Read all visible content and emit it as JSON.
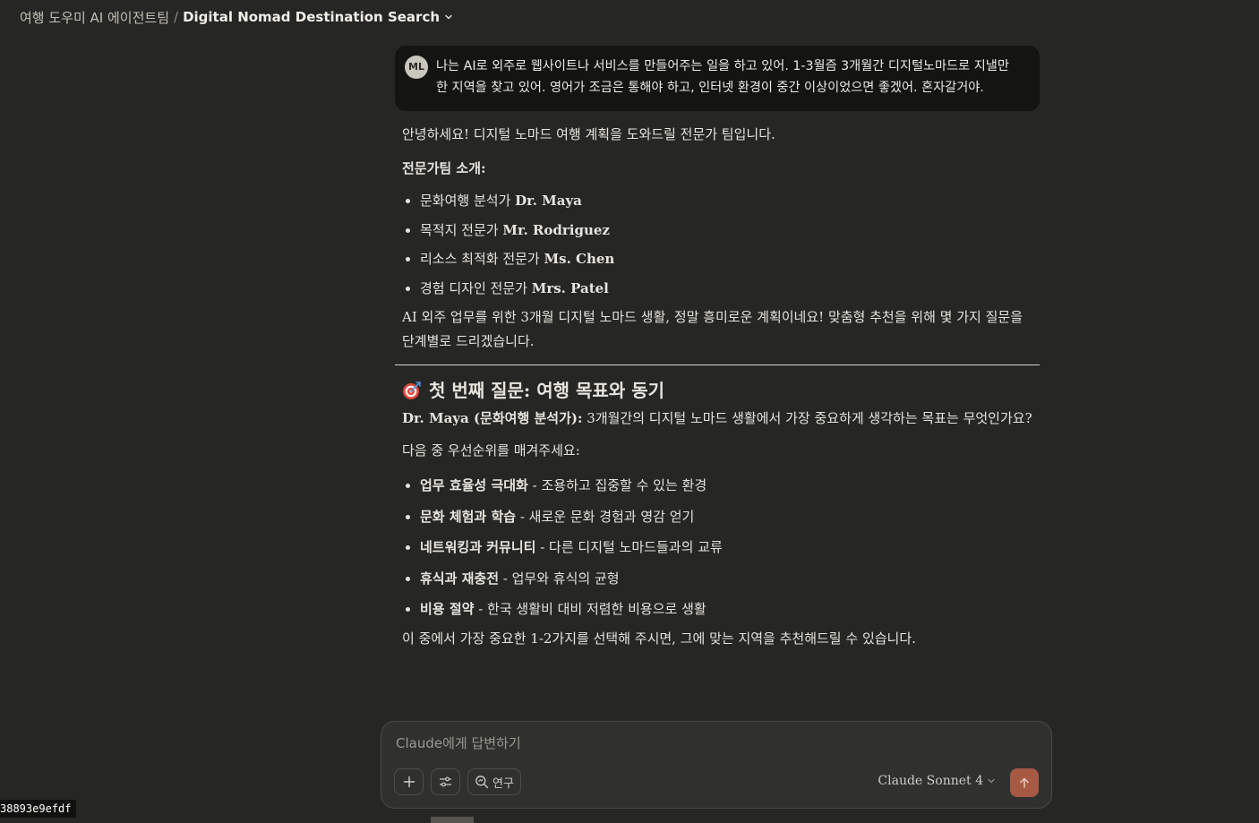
{
  "header": {
    "project": "여행 도우미 AI 에이전트팀",
    "separator": "/",
    "title": "Digital Nomad Destination Search"
  },
  "user_message": {
    "avatar_initials": "ML",
    "text": "나는 AI로 외주로 웹사이트나 서비스를 만들어주는 일을 하고 있어. 1-3월즘 3개월간 디지털노마드로 지낼만한 지역을 찾고 있어. 영어가 조금은 통해야 하고, 인터넷 환경이 중간 이상이었으면 좋겠어. 혼자갈거야."
  },
  "assistant": {
    "intro": "안녕하세요! 디지털 노마드 여행 계획을 도와드릴 전문가 팀입니다.",
    "team_title": "전문가팀 소개:",
    "team": [
      {
        "role": "문화여행 분석가 ",
        "name": "Dr. Maya"
      },
      {
        "role": "목적지 전문가 ",
        "name": "Mr. Rodriguez"
      },
      {
        "role": "리소스 최적화 전문가 ",
        "name": "Ms. Chen"
      },
      {
        "role": "경험 디자인 전문가 ",
        "name": "Mrs. Patel"
      }
    ],
    "para2": "AI 외주 업무를 위한 3개월 디지털 노마드 생활, 정말 흥미로운 계획이네요! 맞춤형 추천을 위해 몇 가지 질문을 단계별로 드리겠습니다.",
    "question_heading": "첫 번째 질문: 여행 목표와 동기",
    "question_speaker": "Dr. Maya (문화여행 분석가):",
    "question_text": " 3개월간의 디지털 노마드 생활에서 가장 중요하게 생각하는 목표는 무엇인가요?",
    "rank_lead": "다음 중 우선순위를 매겨주세요:",
    "priorities": [
      {
        "title": "업무 효율성 극대화",
        "desc": " - 조용하고 집중할 수 있는 환경"
      },
      {
        "title": "문화 체험과 학습",
        "desc": " - 새로운 문화 경험과 영감 얻기"
      },
      {
        "title": "네트워킹과 커뮤니티",
        "desc": " - 다른 디지털 노마드들과의 교류"
      },
      {
        "title": "휴식과 재충전",
        "desc": " - 업무와 휴식의 균형"
      },
      {
        "title": "비용 절약",
        "desc": " - 한국 생활비 대비 저렴한 비용으로 생활"
      }
    ],
    "closing": "이 중에서 가장 중요한 1-2가지를 선택해 주시면, 그에 맞는 지역을 추천해드릴 수 있습니다."
  },
  "composer": {
    "placeholder": "Claude에게 답변하기",
    "research_label": "연구",
    "model": "Claude Sonnet 4"
  },
  "id_badge": "38893e9efdf",
  "colors": {
    "background": "#262624",
    "user_bubble": "#141413",
    "send_button": "#a65a44",
    "target_red": "#d8453b"
  }
}
